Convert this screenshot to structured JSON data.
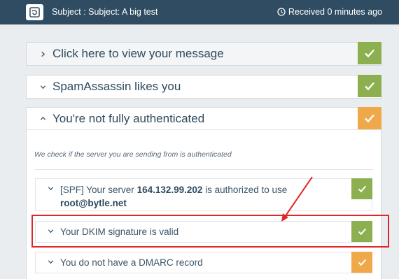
{
  "header": {
    "subject": "Subject : Subject: A big test",
    "received": "Received 0 minutes ago",
    "refresh_icon": "refresh-icon",
    "clock_icon": "clock-icon"
  },
  "panels": [
    {
      "title": "Click here to view your message",
      "status": "ok",
      "chevron": "chevron-right-icon"
    },
    {
      "title": "SpamAssassin likes you",
      "status": "ok",
      "chevron": "chevron-down-icon"
    },
    {
      "title": "You're not fully authenticated",
      "status": "warn",
      "chevron": "chevron-up-icon"
    }
  ],
  "auth": {
    "intro": "We check if the server you are sending from is authenticated",
    "items": [
      {
        "prefix": "[SPF] Your server ",
        "ip": "164.132.99.202",
        "middle": " is authorized to use ",
        "email": "root@bytle.net",
        "status": "ok"
      },
      {
        "text": "Your DKIM signature is valid",
        "status": "ok"
      },
      {
        "text": "You do not have a DMARC record",
        "status": "warn"
      }
    ]
  },
  "colors": {
    "header_bg": "#2f4c62",
    "ok": "#8cb04f",
    "warn": "#f0a94a",
    "annotation": "#e0262b"
  }
}
